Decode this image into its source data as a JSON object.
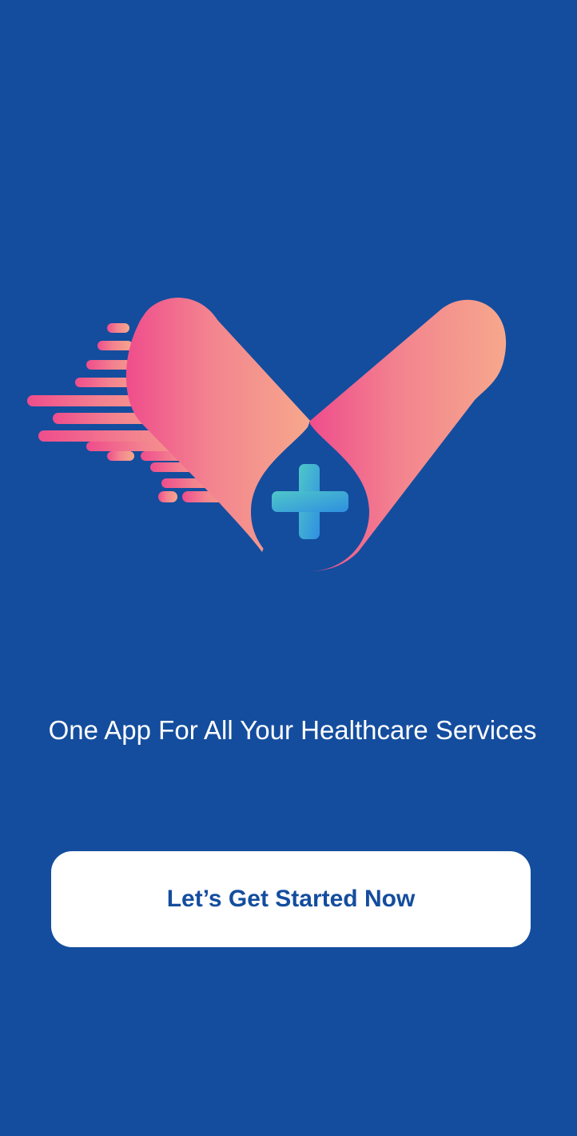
{
  "welcome": {
    "logo_icon": "medical-cross-heart-logo-icon",
    "tagline": "One App For All Your Healthcare Services",
    "cta_label": "Let’s Get Started Now"
  },
  "colors": {
    "background": "#144d9e",
    "button_background": "#ffffff",
    "button_text": "#144d9e",
    "tagline_text": "#ffffff",
    "logo_gradient_start": "#ef4d8c",
    "logo_gradient_end": "#f6a88c",
    "cross_gradient_start": "#4fc7c9",
    "cross_gradient_end": "#2f8fe0"
  }
}
